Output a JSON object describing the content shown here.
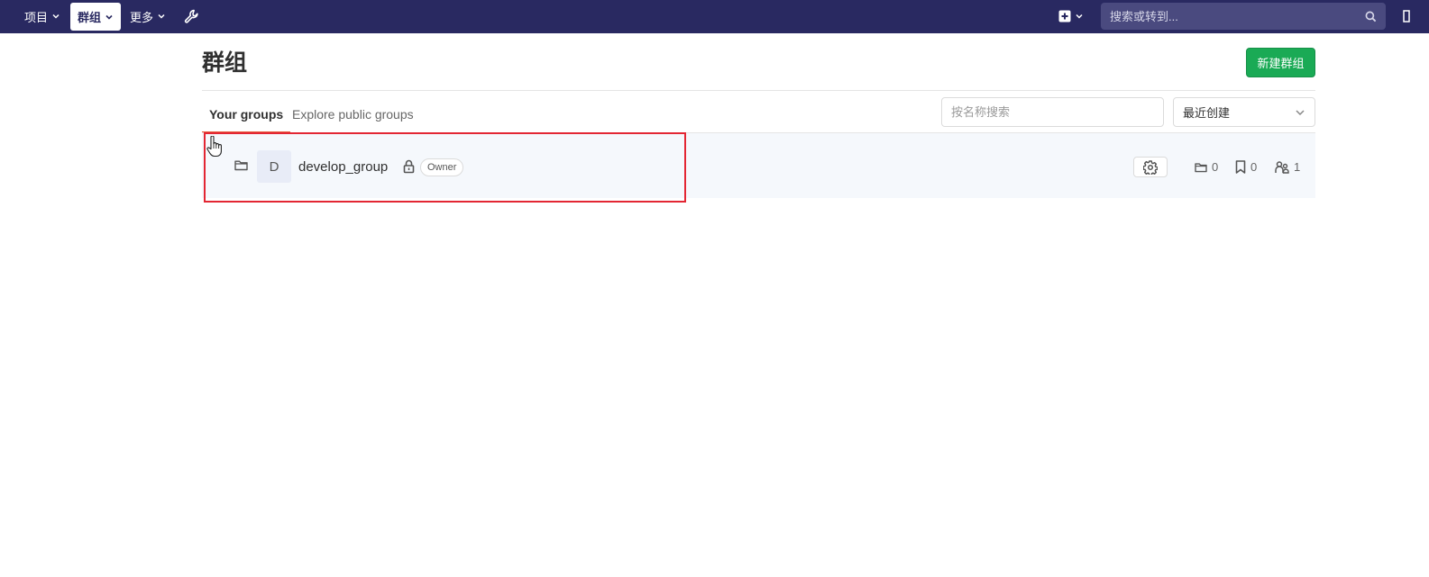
{
  "navbar": {
    "projects_label": "项目",
    "groups_label": "群组",
    "more_label": "更多",
    "search_placeholder": "搜索或转到...",
    "bg_color": "#292961"
  },
  "page": {
    "title": "群组",
    "new_group_button": "新建群组"
  },
  "tabs": [
    {
      "label": "Your groups",
      "active": true
    },
    {
      "label": "Explore public groups",
      "active": false
    }
  ],
  "filter": {
    "search_placeholder": "按名称搜索",
    "sort_selected": "最近创建"
  },
  "groups": [
    {
      "avatar_letter": "D",
      "name": "develop_group",
      "visibility": "private",
      "role": "Owner",
      "subgroups": "0",
      "projects": "0",
      "members": "1"
    }
  ],
  "icons": {
    "nav_admin": "wrench-icon",
    "nav_new": "plus-square-icon",
    "search": "search-icon",
    "folder": "folder-icon",
    "lock": "lock-icon",
    "settings": "gear-icon",
    "projects": "bookmark-icon",
    "members": "users-icon"
  },
  "colors": {
    "primary_button": "#1aaa55",
    "active_tab_underline": "#e75e40",
    "highlight": "#e32633"
  }
}
